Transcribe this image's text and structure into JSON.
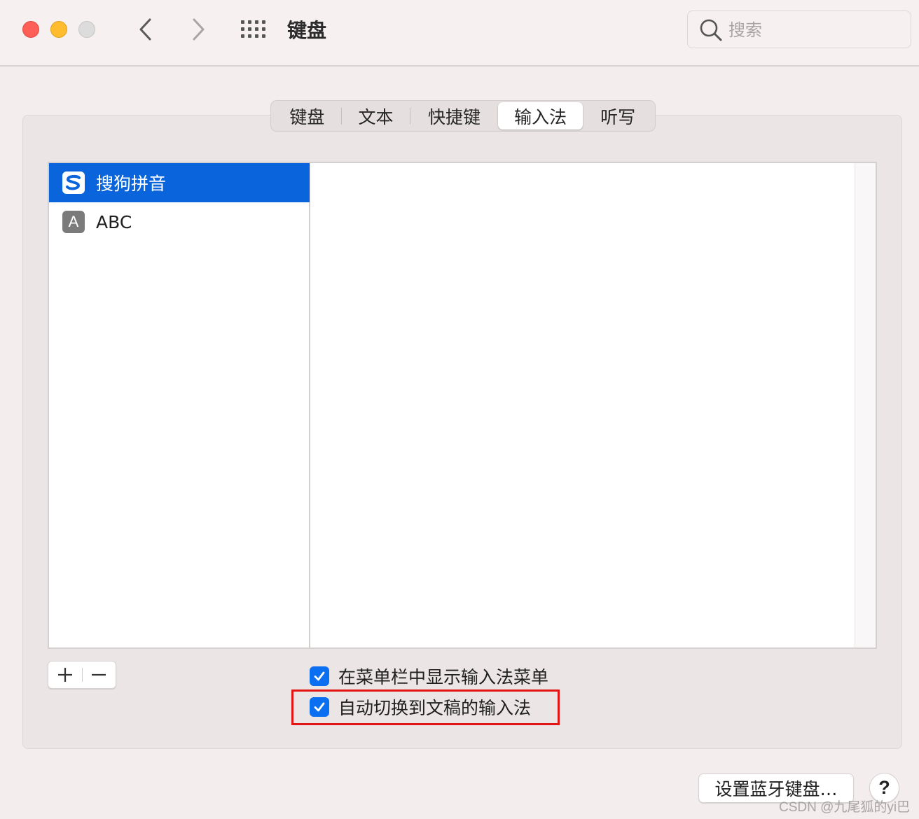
{
  "window": {
    "title": "键盘",
    "search_placeholder": "搜索"
  },
  "tabs": [
    {
      "label": "键盘"
    },
    {
      "label": "文本"
    },
    {
      "label": "快捷键"
    },
    {
      "label": "输入法",
      "selected": true
    },
    {
      "label": "听写"
    }
  ],
  "input_sources": [
    {
      "label": "搜狗拼音",
      "icon": "sogou-icon",
      "selected": true
    },
    {
      "label": "ABC",
      "icon": "abc-icon",
      "icon_letter": "A"
    }
  ],
  "list_controls": {
    "add": "+",
    "remove": "−"
  },
  "options": [
    {
      "label": "在菜单栏中显示输入法菜单",
      "checked": true
    },
    {
      "label": "自动切换到文稿的输入法",
      "checked": true
    }
  ],
  "buttons": {
    "bluetooth_keyboard": "设置蓝牙键盘…",
    "help": "?"
  },
  "watermark": "CSDN @九尾狐的yi巴",
  "colors": {
    "accent": "#0a65dc",
    "checkbox": "#0a6ff0",
    "highlight_box": "#e21414"
  }
}
